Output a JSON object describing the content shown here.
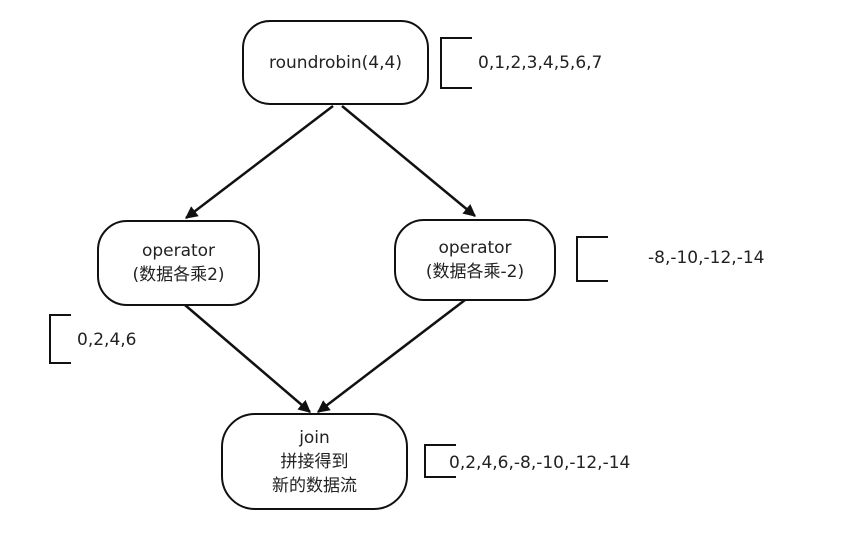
{
  "nodes": {
    "roundrobin": {
      "label": "roundrobin(4,4)"
    },
    "operator_left": {
      "line1": "operator",
      "line2": "(数据各乘2)"
    },
    "operator_right": {
      "line1": "operator",
      "line2": "(数据各乘-2)"
    },
    "join": {
      "line1": "join",
      "line2": "拼接得到",
      "line3": "新的数据流"
    }
  },
  "annotations": {
    "roundrobin_output": "0,1,2,3,4,5,6,7",
    "left_output": "0,2,4,6",
    "right_output": "-8,-10,-12,-14",
    "join_output": "0,2,4,6,-8,-10,-12,-14"
  },
  "edges": [
    {
      "from": "roundrobin",
      "to": "operator_left"
    },
    {
      "from": "roundrobin",
      "to": "operator_right"
    },
    {
      "from": "operator_left",
      "to": "join"
    },
    {
      "from": "operator_right",
      "to": "join"
    }
  ],
  "colors": {
    "stroke": "#111111",
    "text": "#222222",
    "background": "#ffffff"
  }
}
